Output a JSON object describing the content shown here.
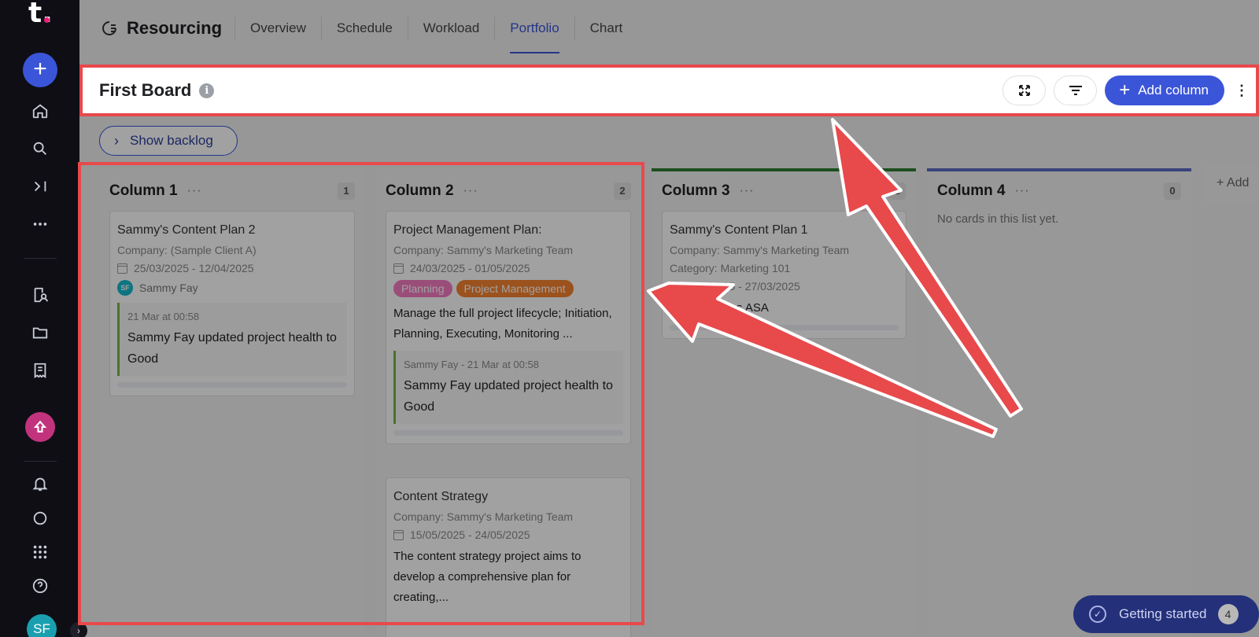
{
  "app": {
    "title": "Resourcing",
    "logo": "t."
  },
  "tabs": [
    {
      "label": "Overview"
    },
    {
      "label": "Schedule"
    },
    {
      "label": "Workload"
    },
    {
      "label": "Portfolio",
      "active": true
    },
    {
      "label": "Chart"
    }
  ],
  "board": {
    "title": "First Board",
    "add_column_label": "Add column",
    "show_backlog_label": "Show backlog"
  },
  "user": {
    "initials": "SF"
  },
  "columns": [
    {
      "title": "Column 1",
      "count": "1",
      "color": "",
      "cards": [
        {
          "title": "Sammy's Content Plan 2",
          "company": "Company: (Sample Client A)",
          "dates": "25/03/2025 - 12/04/2025",
          "assignee": "Sammy Fay",
          "activity_meta": "21 Mar at 00:58",
          "activity_text": "Sammy Fay updated project health to Good"
        }
      ]
    },
    {
      "title": "Column 2",
      "count": "2",
      "color": "",
      "cards": [
        {
          "title": "Project Management Plan:",
          "company": "Company: Sammy's Marketing Team",
          "dates": "24/03/2025 - 01/05/2025",
          "tags": [
            {
              "label": "Planning",
              "color": "#f57ac1"
            },
            {
              "label": "Project Management",
              "color": "#f5822e"
            }
          ],
          "description": "Manage the full project lifecycle; Initiation, Planning, Executing, Monitoring ...",
          "activity_meta": "Sammy Fay - 21 Mar at 00:58",
          "activity_text": "Sammy Fay updated project health to Good"
        },
        {
          "title": "Content Strategy",
          "company": "Company: Sammy's Marketing Team",
          "dates": "15/05/2025 - 24/05/2025",
          "description": "The content strategy project aims to develop a comprehensive plan for creating,..."
        }
      ]
    },
    {
      "title": "Column 3",
      "count": "1",
      "color": "#2e7d32",
      "cards": [
        {
          "title": "Sammy's Content Plan 1",
          "company": "Company: Sammy's Marketing Team",
          "category": "Category: Marketing 101",
          "dates": "...03/2025 - 27/03/2025",
          "description": "...article ideas ASA"
        }
      ]
    },
    {
      "title": "Column 4",
      "count": "0",
      "color": "#5c6bc0",
      "empty_text": "No cards in this list yet."
    }
  ],
  "add_column_stub": "Add",
  "getting_started": {
    "label": "Getting started",
    "count": "4"
  },
  "icons": [
    "plus-icon",
    "home-icon",
    "search-icon",
    "collapse-icon",
    "more-icon",
    "person-doc-icon",
    "folder-icon",
    "receipt-icon",
    "upgrade-icon",
    "bell-icon",
    "chat-icon",
    "apps-icon",
    "help-icon",
    "expand-icon",
    "filter-icon",
    "info-icon",
    "calendar-icon",
    "check-icon"
  ],
  "colors": {
    "accent": "#3b55d9",
    "highlight": "#e8494b",
    "sidebar": "#0e0e14"
  }
}
